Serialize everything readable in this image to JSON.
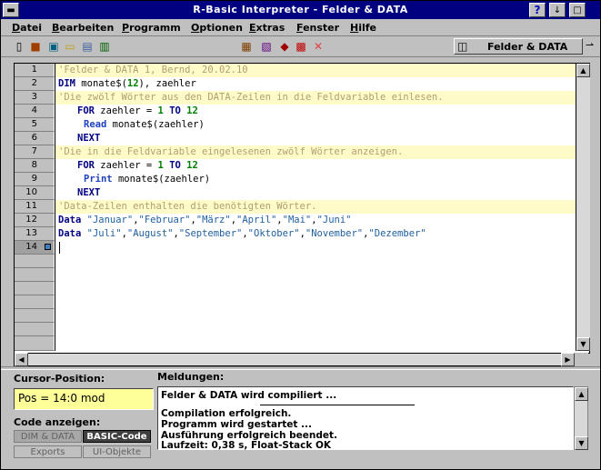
{
  "window": {
    "title": "R-Basic Interpreter - Felder & DATA",
    "help_label": "?",
    "min_label": "↓",
    "max_label": "□"
  },
  "menu": [
    "Datei",
    "Bearbeiten",
    "Programm",
    "Optionen",
    "Extras",
    "Fenster",
    "Hilfe"
  ],
  "toolbar": {
    "document_label": "Felder & DATA"
  },
  "editor": {
    "line_numbers": [
      "1",
      "2",
      "3",
      "4",
      "5",
      "6",
      "7",
      "8",
      "9",
      "10",
      "11",
      "12",
      "13",
      "14"
    ],
    "lines": [
      "'Felder & DATA 1, Bernd, 20.02.10",
      "DIM monate$(12), zaehler",
      "'Die zwölf Wörter aus den DATA-Zeilen in die Feldvariable einlesen.",
      "FOR zaehler = 1 TO 12",
      "Read monate$(zaehler)",
      "NEXT",
      "'Die in die Feldvariable eingelesenen zwölf Wörter anzeigen.",
      "FOR zaehler = 1 TO 12",
      "Print monate$(zaehler)",
      "NEXT",
      "'Data-Zeilen enthalten die benötigten Wörter.",
      "Data \"Januar\",\"Februar\",\"März\",\"April\",\"Mai\",\"Juni\"",
      "Data \"Juli\",\"August\",\"September\",\"Oktober\",\"November\",\"Dezember\"",
      ""
    ]
  },
  "status": {
    "cursor_label": "Cursor-Position:",
    "cursor_value": "Pos = 14:0   mod",
    "code_label": "Code anzeigen:",
    "mode_buttons": [
      "DIM & DATA",
      "BASIC-Code",
      "Exports",
      "UI-Objekte"
    ]
  },
  "messages": {
    "label": "Meldungen:",
    "items": [
      "Felder & DATA wird compiliert ...",
      "Compilation erfolgreich.",
      "Programm wird gestartet ...",
      "Ausführung erfolgreich beendet.",
      "Laufzeit: 0,38 s, Float-Stack OK"
    ]
  }
}
